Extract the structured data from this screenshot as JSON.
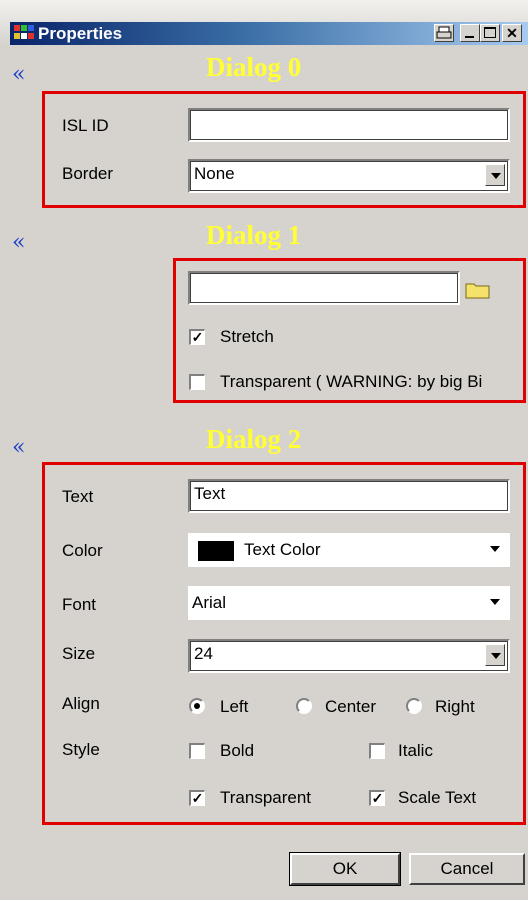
{
  "window": {
    "title": "Properties",
    "controls": [
      "print-icon",
      "minimize-icon",
      "maximize-icon",
      "close-icon"
    ]
  },
  "dialog0": {
    "heading": "Dialog 0",
    "collapse_glyph": "«",
    "isl_id_label": "ISL ID",
    "isl_id_value": "",
    "border_label": "Border",
    "border_value": "None"
  },
  "dialog1": {
    "heading": "Dialog 1",
    "collapse_glyph": "«",
    "path_value": "",
    "stretch_label": "Stretch",
    "stretch_checked": true,
    "transparent_label": "Transparent ( WARNING: by big Bi",
    "transparent_checked": false
  },
  "dialog2": {
    "heading": "Dialog 2",
    "collapse_glyph": "«",
    "text_label": "Text",
    "text_value": "Text",
    "color_label": "Color",
    "color_value": "Text Color",
    "color_swatch": "#000000",
    "font_label": "Font",
    "font_value": "Arial",
    "size_label": "Size",
    "size_value": "24",
    "align_label": "Align",
    "align_options": [
      "Left",
      "Center",
      "Right"
    ],
    "align_selected": "Left",
    "style_label": "Style",
    "bold_label": "Bold",
    "bold_checked": false,
    "italic_label": "Italic",
    "italic_checked": false,
    "transparent_label": "Transparent",
    "transparent_checked": true,
    "scale_label": "Scale Text",
    "scale_checked": true
  },
  "buttons": {
    "ok": "OK",
    "cancel": "Cancel"
  },
  "colors": {
    "accent_red": "#e00000",
    "heading_yellow": "#ffff33",
    "collapse_blue": "#1f3fc7",
    "title_blue": "#0a246a"
  }
}
